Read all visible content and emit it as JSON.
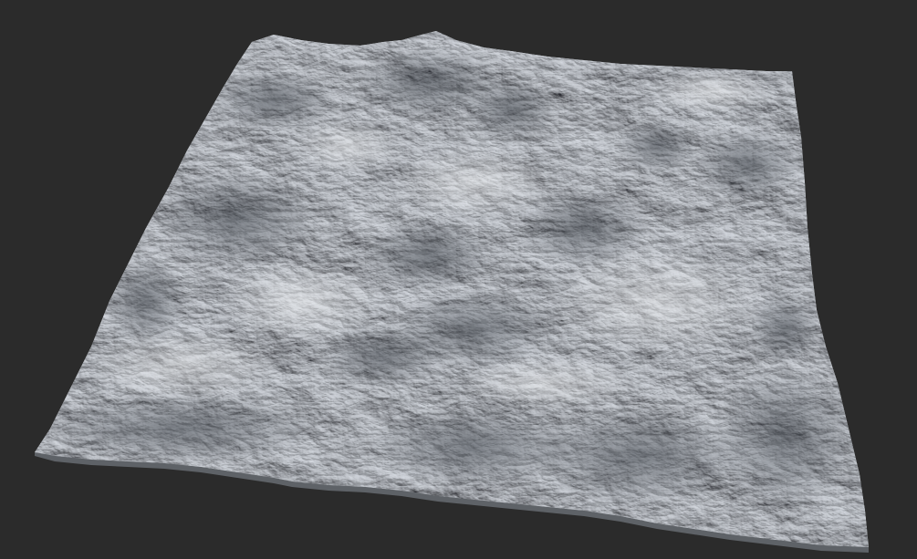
{
  "viewport": {
    "background_color": "#2b2b2b"
  },
  "terrain": {
    "surface_color": "#b9bec3",
    "light_color": "#e4e7ea",
    "shadow_color": "#3f444b",
    "mid_shadow_color": "#7d838a"
  }
}
